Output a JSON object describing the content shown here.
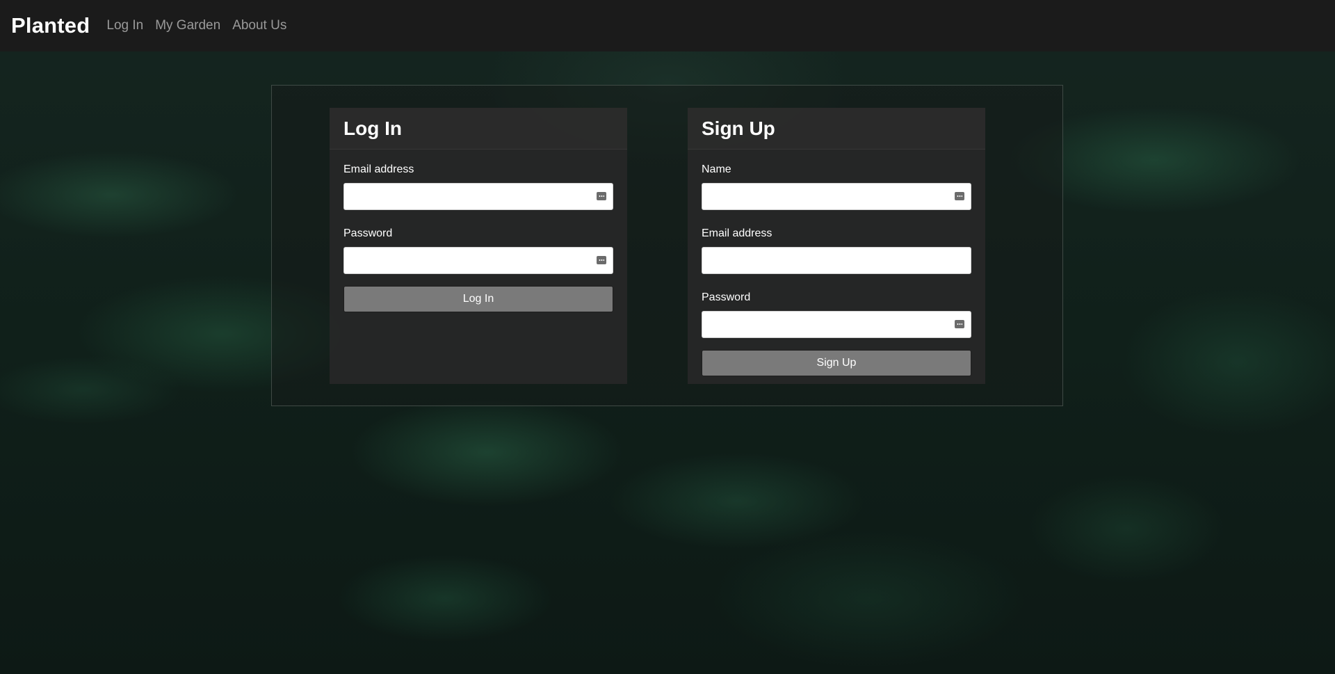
{
  "nav": {
    "brand": "Planted",
    "links": [
      "Log In",
      "My Garden",
      "About Us"
    ]
  },
  "login": {
    "title": "Log In",
    "email_label": "Email address",
    "password_label": "Password",
    "button_label": "Log In"
  },
  "signup": {
    "title": "Sign Up",
    "name_label": "Name",
    "email_label": "Email address",
    "password_label": "Password",
    "button_label": "Sign Up"
  },
  "colors": {
    "navbar_bg": "#1b1b1b",
    "button_bg": "#7a7a7a",
    "card_bg": "#282828"
  }
}
